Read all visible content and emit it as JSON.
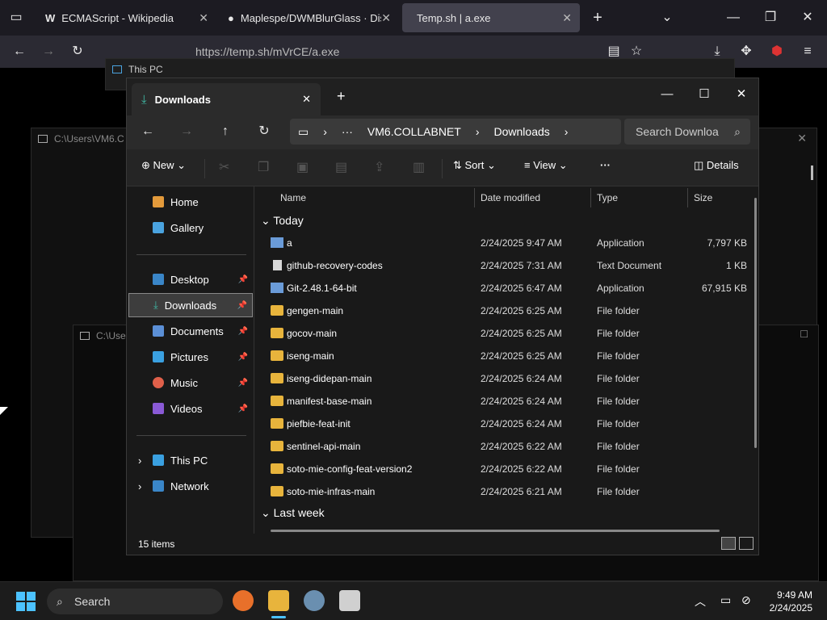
{
  "browser": {
    "tabs": [
      {
        "title": "ECMAScript - Wikipedia"
      },
      {
        "title": "Maplespe/DWMBlurGlass · Disc"
      },
      {
        "title": "Temp.sh | a.exe"
      }
    ],
    "url": "https://temp.sh/mVrCE/a.exe"
  },
  "bg_windows": {
    "left_title": "C:\\Users\\VM6.C",
    "lower_title": "C:\\Use",
    "top_title": "This PC"
  },
  "explorer": {
    "tab_title": "Downloads",
    "breadcrumb": [
      "VM6.COLLABNET",
      "Downloads"
    ],
    "search_placeholder": "Search Downloa",
    "commands": {
      "new": "New",
      "sort": "Sort",
      "view": "View",
      "more": "···",
      "details": "Details"
    },
    "nav": {
      "home": "Home",
      "gallery": "Gallery",
      "desktop": "Desktop",
      "downloads": "Downloads",
      "documents": "Documents",
      "pictures": "Pictures",
      "music": "Music",
      "videos": "Videos",
      "this_pc": "This PC",
      "network": "Network"
    },
    "columns": {
      "name": "Name",
      "date": "Date modified",
      "type": "Type",
      "size": "Size"
    },
    "groups": {
      "today": "Today",
      "last_week": "Last week"
    },
    "files": [
      {
        "name": "a",
        "date": "2/24/2025 9:47 AM",
        "type": "Application",
        "size": "7,797 KB",
        "icon": "app"
      },
      {
        "name": "github-recovery-codes",
        "date": "2/24/2025 7:31 AM",
        "type": "Text Document",
        "size": "1 KB",
        "icon": "file"
      },
      {
        "name": "Git-2.48.1-64-bit",
        "date": "2/24/2025 6:47 AM",
        "type": "Application",
        "size": "67,915 KB",
        "icon": "app"
      },
      {
        "name": "gengen-main",
        "date": "2/24/2025 6:25 AM",
        "type": "File folder",
        "size": "",
        "icon": "folder"
      },
      {
        "name": "gocov-main",
        "date": "2/24/2025 6:25 AM",
        "type": "File folder",
        "size": "",
        "icon": "folder"
      },
      {
        "name": "iseng-main",
        "date": "2/24/2025 6:25 AM",
        "type": "File folder",
        "size": "",
        "icon": "folder"
      },
      {
        "name": "iseng-didepan-main",
        "date": "2/24/2025 6:24 AM",
        "type": "File folder",
        "size": "",
        "icon": "folder"
      },
      {
        "name": "manifest-base-main",
        "date": "2/24/2025 6:24 AM",
        "type": "File folder",
        "size": "",
        "icon": "folder"
      },
      {
        "name": "piefbie-feat-init",
        "date": "2/24/2025 6:24 AM",
        "type": "File folder",
        "size": "",
        "icon": "folder"
      },
      {
        "name": "sentinel-api-main",
        "date": "2/24/2025 6:22 AM",
        "type": "File folder",
        "size": "",
        "icon": "folder"
      },
      {
        "name": "soto-mie-config-feat-version2",
        "date": "2/24/2025 6:22 AM",
        "type": "File folder",
        "size": "",
        "icon": "folder"
      },
      {
        "name": "soto-mie-infras-main",
        "date": "2/24/2025 6:21 AM",
        "type": "File folder",
        "size": "",
        "icon": "folder"
      }
    ],
    "status": "15 items"
  },
  "taskbar": {
    "search": "Search",
    "time": "9:49 AM",
    "date": "2/24/2025"
  },
  "colors": {
    "folder": "#e8b43c",
    "accent": "#0078d4",
    "selected": "#3d3d3d"
  }
}
